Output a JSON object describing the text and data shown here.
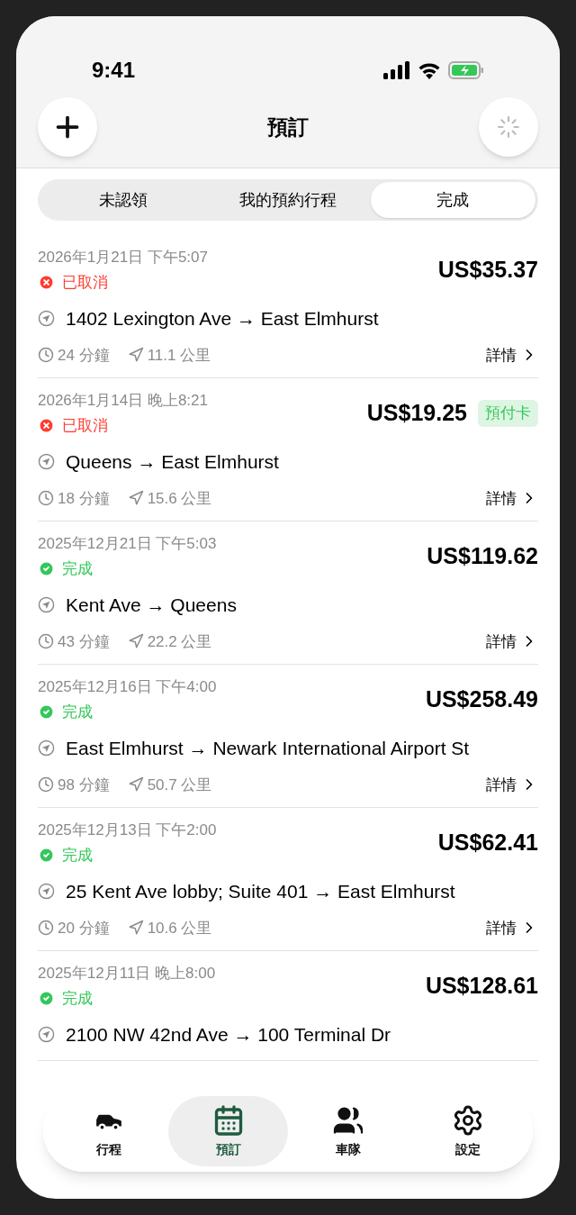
{
  "status_bar": {
    "time": "9:41"
  },
  "header": {
    "title": "預訂"
  },
  "tabs": [
    {
      "label": "未認領",
      "selected": false
    },
    {
      "label": "我的預約行程",
      "selected": false
    },
    {
      "label": "完成",
      "selected": true
    }
  ],
  "bookings": [
    {
      "datetime": "2026年1月21日 下午5:07",
      "status": {
        "kind": "cancelled",
        "label": "已取消"
      },
      "price": "US$35.37",
      "route": "1402 Lexington Ave → East Elmhurst",
      "duration": "24 分鐘",
      "distance": "11.1 公里",
      "details": "詳情"
    },
    {
      "datetime": "2026年1月14日 晚上8:21",
      "status": {
        "kind": "cancelled",
        "label": "已取消"
      },
      "price": "US$19.25",
      "badge": "預付卡",
      "route": "Queens → East Elmhurst",
      "duration": "18 分鐘",
      "distance": "15.6 公里",
      "details": "詳情"
    },
    {
      "datetime": "2025年12月21日 下午5:03",
      "status": {
        "kind": "completed",
        "label": "完成"
      },
      "price": "US$119.62",
      "route": "Kent Ave → Queens",
      "duration": "43 分鐘",
      "distance": "22.2 公里",
      "details": "詳情"
    },
    {
      "datetime": "2025年12月16日 下午4:00",
      "status": {
        "kind": "completed",
        "label": "完成"
      },
      "price": "US$258.49",
      "route": "East Elmhurst → Newark International Airport St",
      "duration": "98 分鐘",
      "distance": "50.7 公里",
      "details": "詳情"
    },
    {
      "datetime": "2025年12月13日 下午2:00",
      "status": {
        "kind": "completed",
        "label": "完成"
      },
      "price": "US$62.41",
      "route": "25 Kent Ave lobby; Suite 401 → East Elmhurst",
      "duration": "20 分鐘",
      "distance": "10.6 公里",
      "details": "詳情"
    },
    {
      "datetime": "2025年12月11日 晚上8:00",
      "status": {
        "kind": "completed",
        "label": "完成"
      },
      "price": "US$128.61",
      "route": "2100 NW 42nd Ave → 100 Terminal Dr"
    }
  ],
  "tab_bar": [
    {
      "kind": "car",
      "label": "行程",
      "selected": false
    },
    {
      "kind": "calendar",
      "label": "預訂",
      "selected": true
    },
    {
      "kind": "people",
      "label": "車隊",
      "selected": false
    },
    {
      "kind": "wheel",
      "label": "設定",
      "selected": false
    }
  ]
}
